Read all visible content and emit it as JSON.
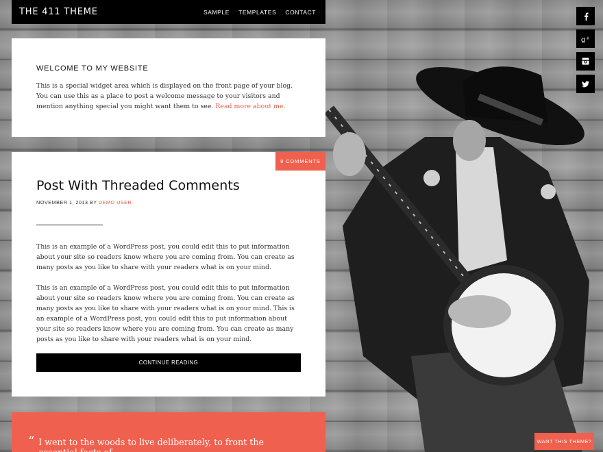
{
  "header": {
    "site_title": "THE 411 THEME",
    "nav": [
      "SAMPLE",
      "TEMPLATES",
      "CONTACT"
    ]
  },
  "social": [
    "facebook-icon",
    "google-plus-icon",
    "instagram-icon",
    "twitter-icon"
  ],
  "welcome": {
    "title": "WELCOME TO MY WEBSITE",
    "text": "This is a special widget area which is displayed on the front page of your blog. You can use this as a place to post a welcome message to your visitors and mention anything special you might want them to see.",
    "link": "Read more about me."
  },
  "post": {
    "comments_badge": "8 COMMENTS",
    "title": "Post With Threaded Comments",
    "date": "NOVEMBER 1, 2013 BY",
    "author": "DEMO USER",
    "paragraph1": "This is an example of a WordPress post, you could edit this to put information about your site so readers know where you are coming from. You can create as many posts as you like to share with your readers what is on your mind.",
    "paragraph2": "This is an example of a WordPress post, you could edit this to put information about your site so readers know where you are coming from. You can create as many posts as you like to share with your readers what is on your mind. This is an example of a WordPress post, you could edit this to put information about your site so readers know where you are coming from. You can create as many posts as you like to share with your readers what is on your mind.",
    "continue_label": "CONTINUE READING"
  },
  "quote": {
    "mark": "“",
    "text": "I went to the woods to live deliberately, to front the essential facts of"
  },
  "want_theme_label": "WANT THIS THEME?",
  "colors": {
    "accent": "#f0604e",
    "header_bg": "#000000",
    "card_bg": "#ffffff"
  }
}
